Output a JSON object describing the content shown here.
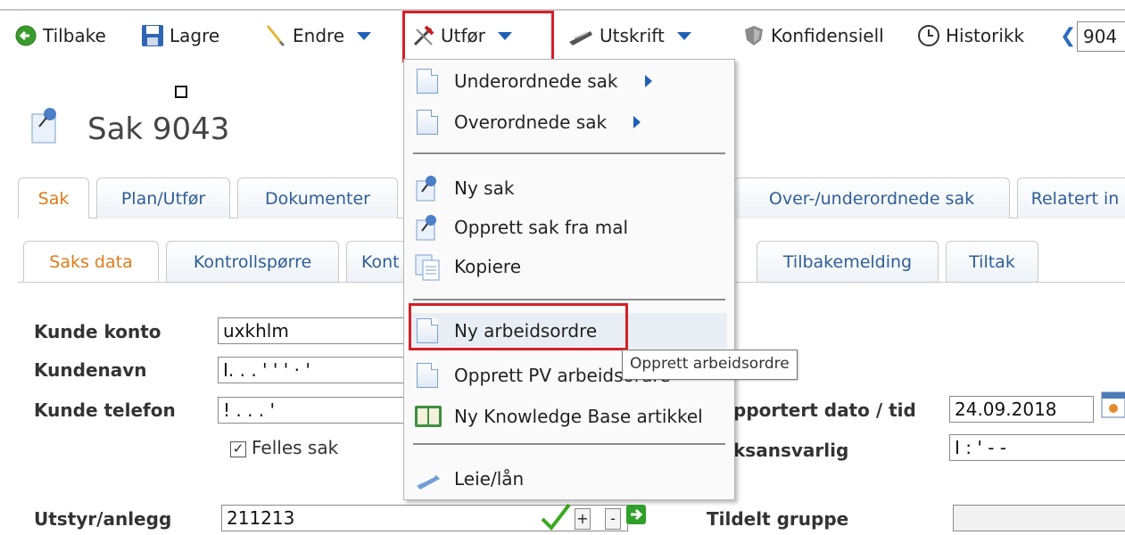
{
  "toolbar": {
    "back_label": "Tilbake",
    "save_label": "Lagre",
    "edit_label": "Endre",
    "execute_label": "Utfør",
    "print_label": "Utskrift",
    "confidential_label": "Konfidensiell",
    "history_label": "Historikk",
    "history_value": "904"
  },
  "page": {
    "title": "Sak 9043"
  },
  "tabs": [
    {
      "label": "Sak",
      "active": true
    },
    {
      "label": "Plan/Utfør"
    },
    {
      "label": "Dokumenter"
    },
    {
      "label": "Over-/underordnede sak"
    },
    {
      "label": "Relatert in"
    }
  ],
  "subtabs": [
    {
      "label": "Saks data",
      "active": true
    },
    {
      "label": "Kontrollspørre"
    },
    {
      "label": "Kont"
    },
    {
      "label": "Tilbakemelding"
    },
    {
      "label": "Tiltak"
    }
  ],
  "form": {
    "customer_account_label": "Kunde konto",
    "customer_account_value": "uxkhlm",
    "customer_name_label": "Kundenavn",
    "customer_name_value": "I.  .  .  ' ' ' ·  '",
    "customer_phone_label": "Kunde telefon",
    "customer_phone_value": "! .  .  . '",
    "shared_case_label": "Felles sak",
    "shared_case_checked": true,
    "reported_label": "pportert dato / tid",
    "reported_value": "24.09.2018",
    "responsible_label": "ksansvarlig",
    "responsible_value": "I    :     ' - -",
    "equipment_label": "Utstyr/anlegg",
    "equipment_value": "211213",
    "assigned_group_label": "Tildelt gruppe",
    "assigned_group_value": ""
  },
  "menu": {
    "items": [
      {
        "label": "Underordnede sak",
        "submenu": true
      },
      {
        "label": "Overordnede sak",
        "submenu": true
      },
      {
        "label": "Ny sak"
      },
      {
        "label": "Opprett sak fra mal"
      },
      {
        "label": "Kopiere"
      },
      {
        "label": "Ny arbeidsordre"
      },
      {
        "label": "Opprett PV arbeidsordre"
      },
      {
        "label": "Ny Knowledge Base artikkel"
      },
      {
        "label": "Leie/lån"
      }
    ],
    "tooltip": "Opprett arbeidsordre"
  },
  "colors": {
    "highlight_border": "#d61f26",
    "active_tab_text": "#e07b1a",
    "tab_text": "#2e5f98",
    "check_icon": "#3aa81f"
  }
}
